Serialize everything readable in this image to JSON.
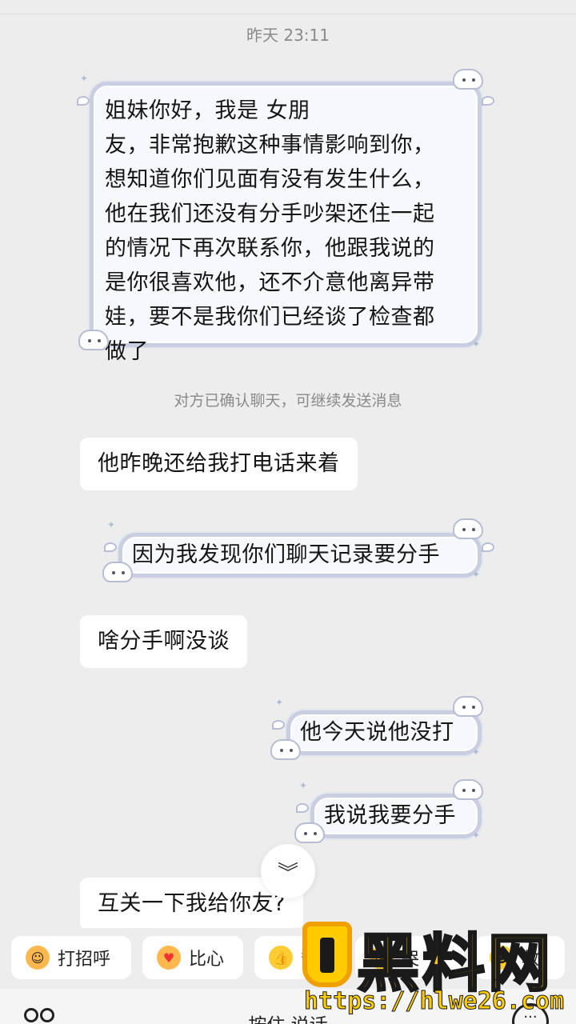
{
  "chat": {
    "timestamp": "昨天 23:11",
    "first_message_lines": [
      "姐妹你好，我是                女朋",
      "友，非常抱歉这种事情影响到你，",
      "想知道你们见面有没有发生什么，",
      "他在我们还没有分手吵架还住一起",
      "的情况下再次联系你，他跟我说的",
      "是你很喜欢他，还不介意他离异带",
      "娃，要不是我你们已经谈了检查都",
      "做了"
    ],
    "system_note": "对方已确认聊天，可继续发送消息",
    "msg_received_1": "他昨晚还给我打电话来着",
    "msg_sent_2": "因为我发现你们聊天记录要分手",
    "msg_received_3": "啥分手啊没谈",
    "msg_sent_4": "他今天说他没打",
    "msg_sent_5": "我说我要分手",
    "msg_received_6": "互关一下我给你友?"
  },
  "quick_replies": {
    "hello": "打招呼",
    "heart": "比心",
    "thumb": "赞",
    "cry": "哭",
    "rescue": "救"
  },
  "input": {
    "hold_to_talk": "按住 说话"
  },
  "watermark": {
    "title": "黑料网",
    "url": "https://hlwe26.com"
  },
  "colors": {
    "background": "#ededed",
    "bubble_border": "#c9cfe0",
    "watermark_yellow": "#ffcc00"
  }
}
